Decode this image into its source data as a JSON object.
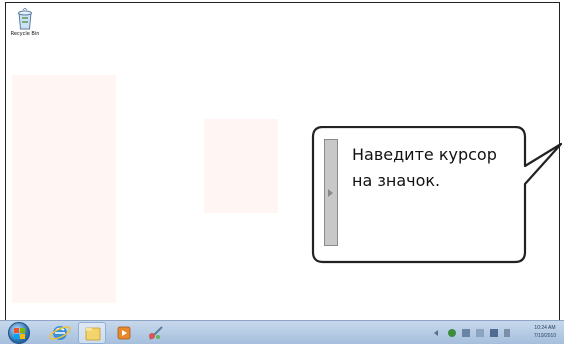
{
  "desktop": {
    "icons": [
      {
        "label": "Recycle Bin",
        "icon": "recycle-bin-icon"
      }
    ]
  },
  "callout": {
    "text": "Наведите курсор на значок."
  },
  "taskbar": {
    "buttons": [
      {
        "name": "start-button",
        "icon": "windows-orb-icon"
      },
      {
        "name": "internet-explorer",
        "icon": "internet-explorer-icon"
      },
      {
        "name": "windows-explorer",
        "icon": "folder-icon"
      },
      {
        "name": "media-player",
        "icon": "media-player-icon"
      },
      {
        "name": "paint",
        "icon": "paint-icon"
      }
    ],
    "clock": {
      "time": "10:24 AM",
      "date": "7/19/2010"
    }
  },
  "colors": {
    "taskbar": "#b5cae4",
    "callout_border": "#222222",
    "panel": "#c8c8c8",
    "ghost": "#fff6f4"
  }
}
